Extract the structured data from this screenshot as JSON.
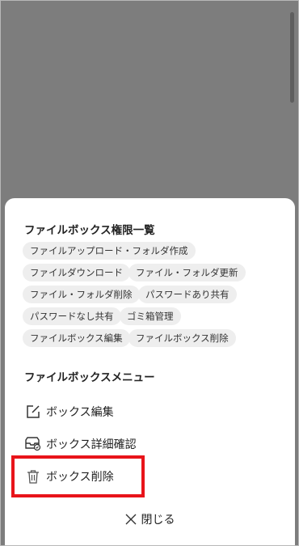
{
  "permissions": {
    "title": "ファイルボックス権限一覧",
    "chips": [
      "ファイルアップロード・フォルダ作成",
      "ファイルダウンロード",
      "ファイル・フォルダ更新",
      "ファイル・フォルダ削除",
      "パスワードあり共有",
      "パスワードなし共有",
      "ゴミ箱管理",
      "ファイルボックス編集",
      "ファイルボックス削除"
    ]
  },
  "menu": {
    "title": "ファイルボックスメニュー",
    "items": [
      {
        "label": "ボックス編集",
        "icon": "edit-icon"
      },
      {
        "label": "ボックス詳細確認",
        "icon": "inbox-detail-icon"
      },
      {
        "label": "ボックス削除",
        "icon": "trash-icon"
      }
    ]
  },
  "close": {
    "label": "閉じる",
    "icon": "close-icon"
  },
  "colors": {
    "highlight": "#e8141a",
    "overlay": "#7d7d7d",
    "chip_bg": "#eeeeee"
  }
}
